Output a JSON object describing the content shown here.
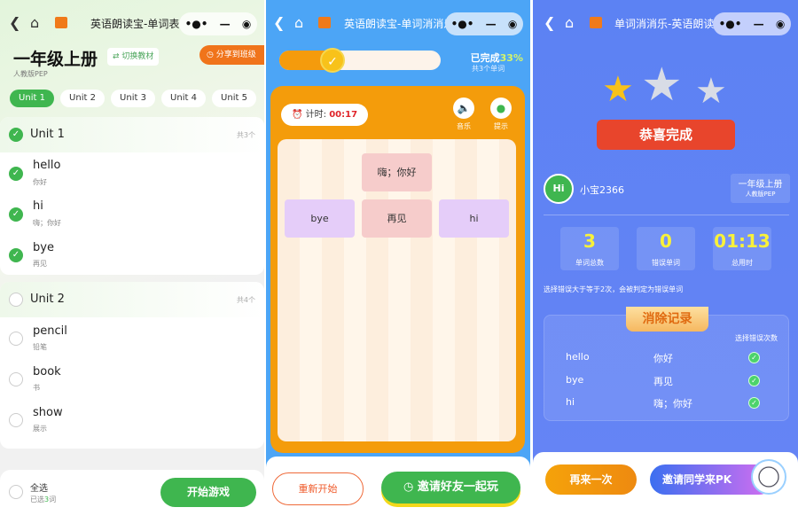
{
  "panel1": {
    "nav_title": "英语朗读宝-单词表",
    "book_title": "一年级上册",
    "switch_label": "切换教材",
    "share_label": "分享到班级",
    "edition": "人教版PEP",
    "tabs": [
      "Unit 1",
      "Unit 2",
      "Unit 3",
      "Unit 4",
      "Unit 5"
    ],
    "units": [
      {
        "name": "Unit 1",
        "count": "共3个",
        "checked": true,
        "words": [
          {
            "w": "hello",
            "m": "你好"
          },
          {
            "w": "hi",
            "m": "嗨；你好"
          },
          {
            "w": "bye",
            "m": "再见"
          }
        ]
      },
      {
        "name": "Unit 2",
        "count": "共4个",
        "checked": false,
        "words": [
          {
            "w": "pencil",
            "m": "铅笔"
          },
          {
            "w": "book",
            "m": "书"
          },
          {
            "w": "show",
            "m": "展示"
          }
        ]
      }
    ],
    "select_all": "全选",
    "selected_prefix": "已选",
    "selected_count": "3",
    "selected_suffix": "词",
    "start_button": "开始游戏"
  },
  "panel2": {
    "nav_title": "英语朗读宝-单词消消乐",
    "progress": 33,
    "done_label": "已完成",
    "done_pct": "33%",
    "total_label": "共3个单词",
    "timer_label": "计时:",
    "timer_value": "00:17",
    "music_label": "音乐",
    "hint_label": "提示",
    "tiles": [
      {
        "text": "嗨；你好",
        "color": "#f6cccb"
      },
      {
        "text": "bye",
        "color": "#e5cdf9"
      },
      {
        "text": "再见",
        "color": "#f6cccb"
      },
      {
        "text": "hi",
        "color": "#e5cdf9"
      }
    ],
    "restart_button": "重新开始",
    "invite_button": "邀请好友一起玩"
  },
  "panel3": {
    "nav_title": "单词消消乐-英语朗读宝",
    "banner": "恭喜完成",
    "avatar_text": "Hi",
    "username": "小宝2366",
    "book_title": "一年级上册",
    "edition": "人教版PEP",
    "stats": [
      {
        "value": "3",
        "label": "单词总数"
      },
      {
        "value": "0",
        "label": "错误单词"
      },
      {
        "value": "01:13",
        "label": "总用时"
      }
    ],
    "note": "选择错误大于等于2次，会被判定为错误单词",
    "record_title": "消除记录",
    "record_col": "选择错误次数",
    "records": [
      {
        "w": "hello",
        "m": "你好"
      },
      {
        "w": "bye",
        "m": "再见"
      },
      {
        "w": "hi",
        "m": "嗨；你好"
      }
    ],
    "retry_button": "再来一次",
    "pk_button": "邀请同学来PK"
  }
}
